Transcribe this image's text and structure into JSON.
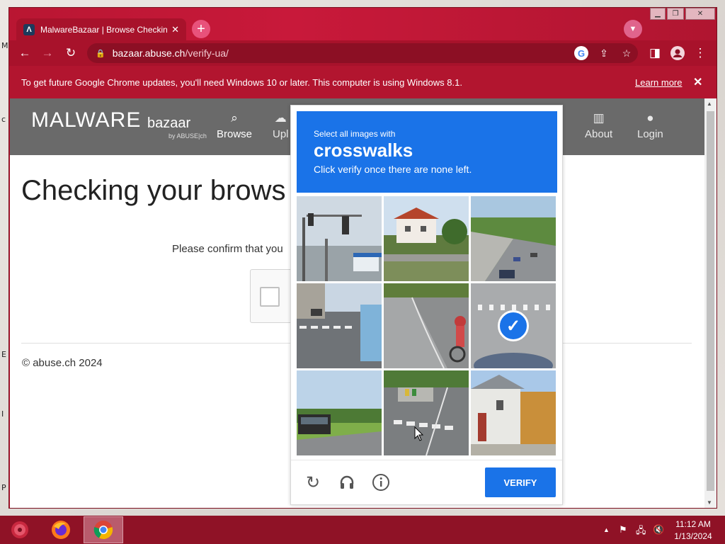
{
  "browser": {
    "tab_title": "MalwareBazaar | Browse Checking",
    "tab_favicon": "Λ",
    "url_domain": "bazaar.abuse.ch",
    "url_path": "/verify-ua/",
    "infobar_text": "To get future Google Chrome updates, you'll need Windows 10 or later. This computer is using Windows 8.1.",
    "infobar_link": "Learn more",
    "accent_color": "#b2152f"
  },
  "site": {
    "logo_main": "MALWARE",
    "logo_sub": "bazaar",
    "logo_by": "by ABUSE|ch",
    "nav": [
      {
        "label": "Browse",
        "icon": "search-icon"
      },
      {
        "label": "Upl",
        "icon": "upload-icon"
      },
      {
        "label": "About",
        "icon": "building-icon"
      },
      {
        "label": "Login",
        "icon": "user-icon"
      }
    ],
    "heading": "Checking your brows",
    "confirm_text": "Please confirm that you",
    "footer": "© abuse.ch 2024"
  },
  "captcha": {
    "prompt_pre": "Select all images with",
    "prompt_word": "crosswalks",
    "prompt_post": "Click verify once there are none left.",
    "verify_label": "VERIFY",
    "header_color": "#1a73e8",
    "tiles": [
      {
        "scene": "traffic-lights",
        "selected": false
      },
      {
        "scene": "houses-bridge",
        "selected": false
      },
      {
        "scene": "road-trees",
        "selected": false
      },
      {
        "scene": "street-bus-crosswalk",
        "selected": false
      },
      {
        "scene": "cyclist-road",
        "selected": false
      },
      {
        "scene": "crosswalk-car",
        "selected": true
      },
      {
        "scene": "bus-field",
        "selected": false
      },
      {
        "scene": "street-crosswalk",
        "selected": false
      },
      {
        "scene": "building-trees",
        "selected": false
      }
    ]
  },
  "taskbar": {
    "time": "11:12 AM",
    "date": "1/13/2024"
  }
}
